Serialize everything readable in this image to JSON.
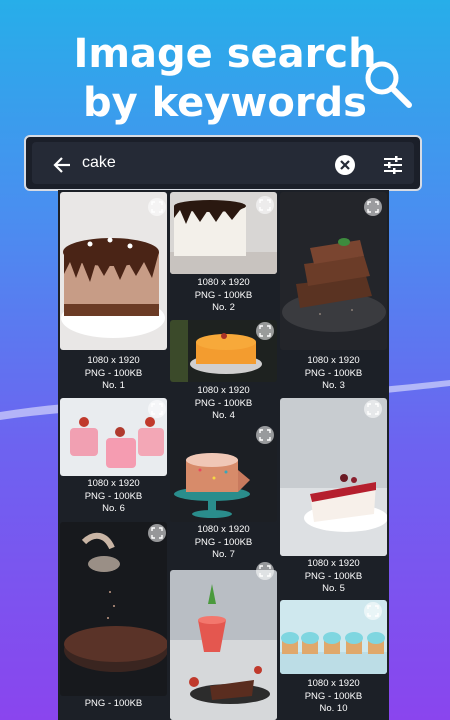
{
  "headline": {
    "line1": "Image search",
    "line2": "by keywords"
  },
  "search": {
    "query": "cake"
  },
  "icons": {
    "back": "arrow-left-icon",
    "clear": "close-circle-icon",
    "filter": "tune-icon",
    "hero": "magnifier-icon",
    "expand": "expand-icon"
  },
  "results": [
    {
      "size": "1080 x 1920",
      "format": "PNG - 100KB",
      "number": "No. 1"
    },
    {
      "size": "1080 x 1920",
      "format": "PNG - 100KB",
      "number": "No. 2"
    },
    {
      "size": "1080 x 1920",
      "format": "PNG - 100KB",
      "number": "No. 3"
    },
    {
      "size": "1080 x 1920",
      "format": "PNG - 100KB",
      "number": "No. 4"
    },
    {
      "size": "1080 x 1920",
      "format": "PNG - 100KB",
      "number": "No. 6"
    },
    {
      "size": "1080 x 1920",
      "format": "PNG - 100KB",
      "number": "No. 7"
    },
    {
      "size": "1080 x 1920",
      "format": "PNG - 100KB",
      "number": "No. 5"
    },
    {
      "size": "1080 x 1920",
      "format": "PNG - 100KB",
      "number": "No. 10"
    },
    {
      "size": "",
      "format": "PNG - 100KB",
      "number": ""
    }
  ]
}
